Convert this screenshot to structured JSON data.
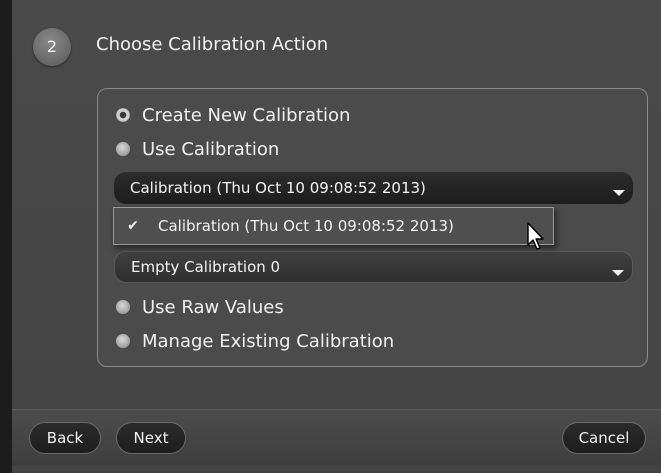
{
  "step": {
    "number": "2",
    "title": "Choose Calibration Action"
  },
  "options": [
    {
      "label": "Create New Calibration",
      "checked": true
    },
    {
      "label": "Use Calibration",
      "checked": false
    },
    {
      "label": "Use Raw Values",
      "checked": false
    },
    {
      "label": "Manage Existing Calibration",
      "checked": false
    }
  ],
  "calibration_combo": {
    "value": "Calibration (Thu Oct 10 09:08:52 2013)"
  },
  "calibration_popup": {
    "items": [
      {
        "label": "Calibration (Thu Oct 10 09:08:52 2013)",
        "selected": true
      }
    ]
  },
  "second_combo": {
    "value": "Empty Calibration 0"
  },
  "buttons": {
    "back": "Back",
    "next": "Next",
    "cancel": "Cancel"
  },
  "icons": {
    "check": "check-icon",
    "dropdown": "chevron-down-icon",
    "cursor": "mouse-pointer-icon"
  }
}
